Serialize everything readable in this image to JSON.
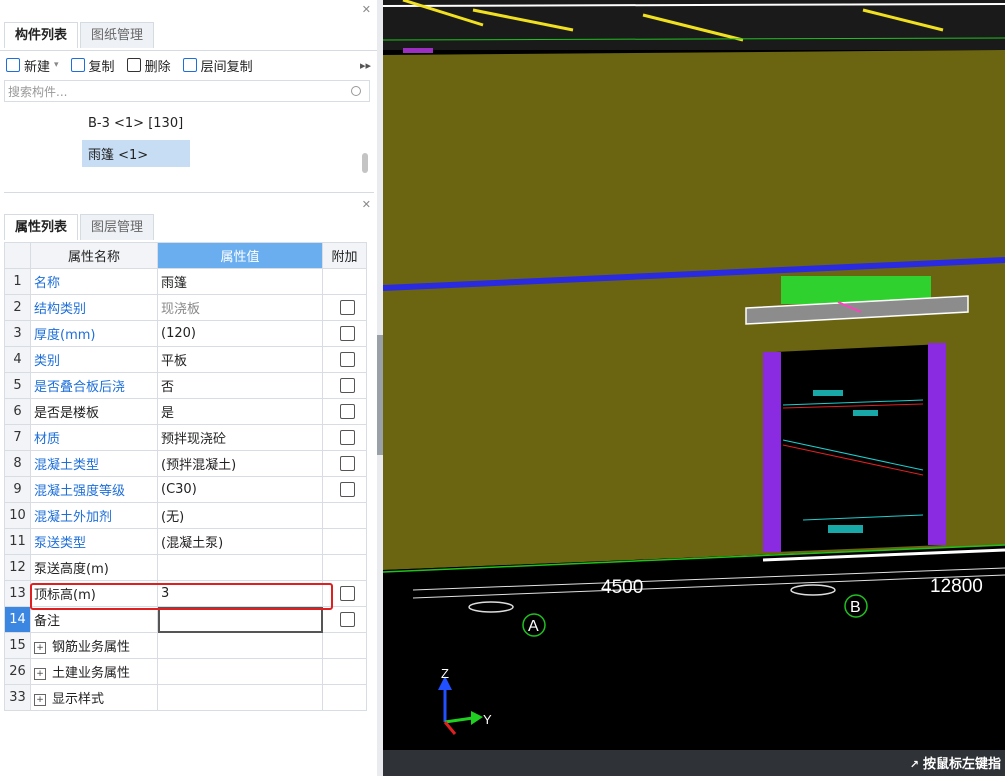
{
  "component_panel": {
    "tabs": [
      "构件列表",
      "图纸管理"
    ],
    "toolbar": {
      "new_label": "新建",
      "copy_label": "复制",
      "delete_label": "删除",
      "floor_copy_label": "层间复制",
      "more": "▸▸"
    },
    "search_placeholder": "搜索构件...",
    "tree_items": [
      "B-3 <1> [130]",
      "雨篷 <1>"
    ]
  },
  "property_panel": {
    "tabs": [
      "属性列表",
      "图层管理"
    ],
    "headers": {
      "name": "属性名称",
      "value": "属性值",
      "extra": "附加"
    },
    "rows": [
      {
        "num": "1",
        "name": "名称",
        "value": "雨篷"
      },
      {
        "num": "2",
        "name": "结构类别",
        "value": "现浇板"
      },
      {
        "num": "3",
        "name": "厚度(mm)",
        "value": "(120)"
      },
      {
        "num": "4",
        "name": "类别",
        "value": "平板"
      },
      {
        "num": "5",
        "name": "是否叠合板后浇",
        "value": "否"
      },
      {
        "num": "6",
        "name": "是否是楼板",
        "value": "是"
      },
      {
        "num": "7",
        "name": "材质",
        "value": "预拌现浇砼"
      },
      {
        "num": "8",
        "name": "混凝土类型",
        "value": "(预拌混凝土)"
      },
      {
        "num": "9",
        "name": "混凝土强度等级",
        "value": "(C30)"
      },
      {
        "num": "10",
        "name": "混凝土外加剂",
        "value": "(无)"
      },
      {
        "num": "11",
        "name": "泵送类型",
        "value": "(混凝土泵)"
      },
      {
        "num": "12",
        "name": "泵送高度(m)",
        "value": ""
      },
      {
        "num": "13",
        "name": "顶标高(m)",
        "value": "3"
      },
      {
        "num": "14",
        "name": "备注",
        "value": ""
      },
      {
        "num": "15",
        "name": "钢筋业务属性",
        "value": ""
      },
      {
        "num": "26",
        "name": "土建业务属性",
        "value": ""
      },
      {
        "num": "33",
        "name": "显示样式",
        "value": ""
      }
    ]
  },
  "viewport": {
    "dimension_left": "4500",
    "dimension_right": "12800",
    "axis_a": "A",
    "axis_b": "B",
    "axis_z": "Z",
    "axis_y": "Y",
    "status_text": "按鼠标左键指"
  },
  "colors": {
    "wall": "#6b6512",
    "blue_line": "#2a2ae0",
    "green_strip": "#2ed12e",
    "purple_frame": "#8a2be2",
    "highlight_box": "#e02020"
  }
}
